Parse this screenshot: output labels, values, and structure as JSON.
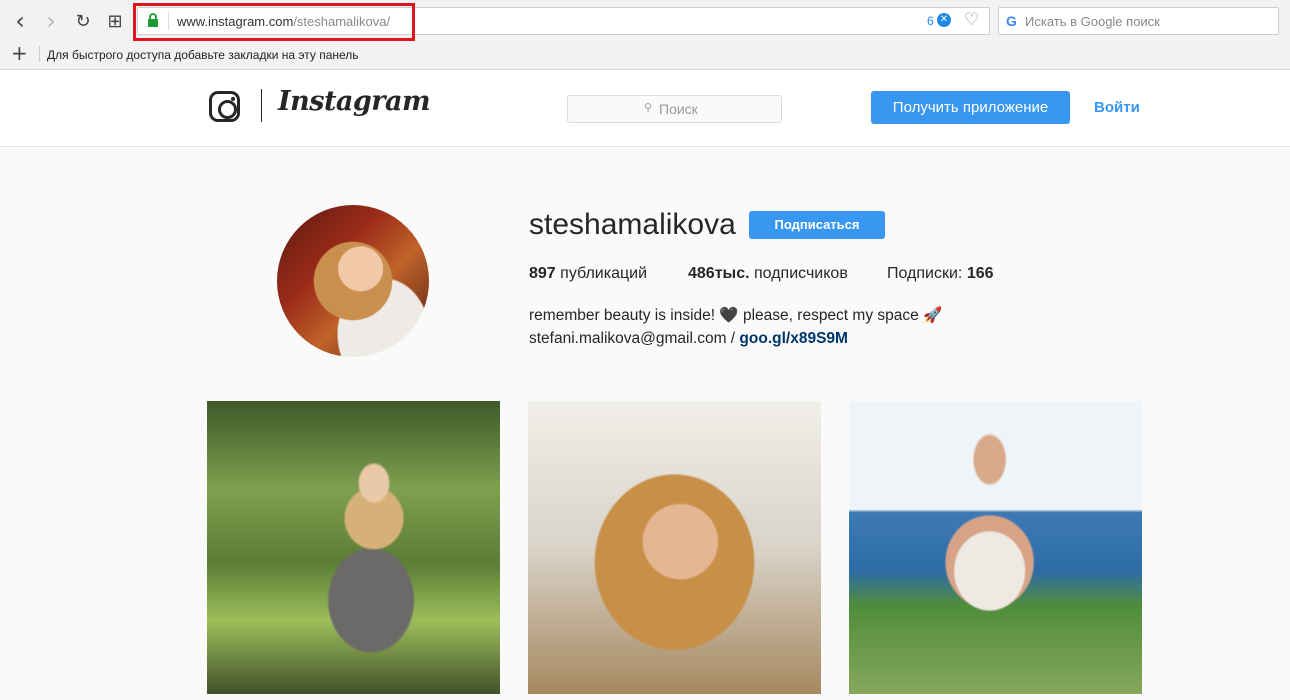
{
  "browser": {
    "back_icon": "‹",
    "forward_icon": "›",
    "reload_icon": "↻",
    "speeddial_icon": "⊞",
    "url_host": "www.instagram.com",
    "url_path": "/steshamalikova/",
    "adblock_count": "6",
    "adblock_icon": "✕",
    "heart_icon": "♡",
    "search_engine_icon": "G",
    "search_placeholder": "Искать в Google поиск",
    "bookmark_add_icon": "+",
    "bookmarks_hint": "Для быстрого доступа добавьте закладки на эту панель",
    "highlight_color": "#e0141e"
  },
  "header": {
    "wordmark": "Instagram",
    "search_icon": "⚲",
    "search_placeholder": "Поиск",
    "get_app_label": "Получить приложение",
    "login_label": "Войти",
    "accent_color": "#3897f0"
  },
  "profile": {
    "username": "steshamalikova",
    "follow_label": "Подписаться",
    "posts_count": "897",
    "posts_label": " публикаций",
    "followers_count": "486тыс.",
    "followers_label": " подписчиков",
    "following_label": "Подписки: ",
    "following_count": "166",
    "bio_line1": "remember beauty is inside! 🖤 please, respect my space 🚀",
    "bio_email": "stefani.malikova@gmail.com / ",
    "bio_link": "goo.gl/x89S9M"
  },
  "posts": [
    "post-1",
    "post-2",
    "post-3"
  ]
}
